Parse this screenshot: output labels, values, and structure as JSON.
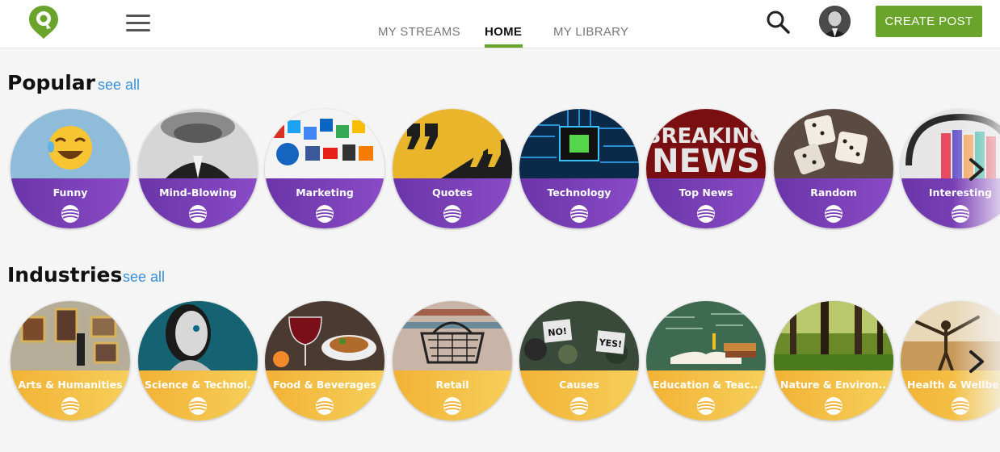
{
  "header": {
    "nav": [
      "MY STREAMS",
      "HOME",
      "MY LIBRARY"
    ],
    "create_post": "CREATE POST"
  },
  "popular": {
    "title": "Popular",
    "see_all": "see all",
    "items": [
      "Funny",
      "Mind-Blowing",
      "Marketing",
      "Quotes",
      "Technology",
      "Top News",
      "Random",
      "Interesting"
    ]
  },
  "industries": {
    "title": "Industries",
    "see_all": "see all",
    "items": [
      "Arts & Humanities",
      "Science & Technol...",
      "Food & Beverages",
      "Retail",
      "Causes",
      "Education & Teac...",
      "Nature & Environ...",
      "Health & Wellbeing"
    ]
  },
  "image_text": {
    "news_line1": "BREAKING",
    "news_line2": "NEWS",
    "sign_no": "NO!",
    "sign_yes": "YES!"
  },
  "colors": {
    "brand_green": "#6aa42b",
    "popular_band": "#7a3fb8",
    "industries_band": "#f4bf45",
    "link": "#3a8fd8"
  }
}
